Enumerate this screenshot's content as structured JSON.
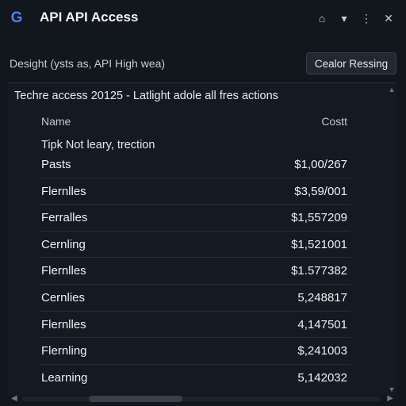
{
  "window": {
    "title": "API API Access",
    "logo_letter": "G",
    "controls": {
      "home": "⌂",
      "dropdown": "▾",
      "more": "⋮",
      "close": "✕"
    }
  },
  "toolbar": {
    "description": "Desight (ysts as, API High wea)",
    "button_label": "Cealor Ressing"
  },
  "panel": {
    "caption": "Techre access 20125 - Latlight adole all fres actions",
    "columns": {
      "name": "Name",
      "cost": "Costt"
    },
    "tip": "Tipk Not leary, trection",
    "rows": [
      {
        "name": "Pasts",
        "cost": "$1,00/267"
      },
      {
        "name": "Flernlles",
        "cost": "$3,59/001"
      },
      {
        "name": "Ferralles",
        "cost": "$1,557209"
      },
      {
        "name": "Cernling",
        "cost": "$1,521001"
      },
      {
        "name": "Flernlles",
        "cost": "$1.577382"
      },
      {
        "name": "Cernlies",
        "cost": "5,248817"
      },
      {
        "name": "Flernlles",
        "cost": "4,147501"
      },
      {
        "name": "Flernling",
        "cost": "$,241003"
      },
      {
        "name": "Learning",
        "cost": "5,142032"
      }
    ]
  },
  "scroll": {
    "up": "▲",
    "down": "▼",
    "left": "◀",
    "right": "▶"
  }
}
